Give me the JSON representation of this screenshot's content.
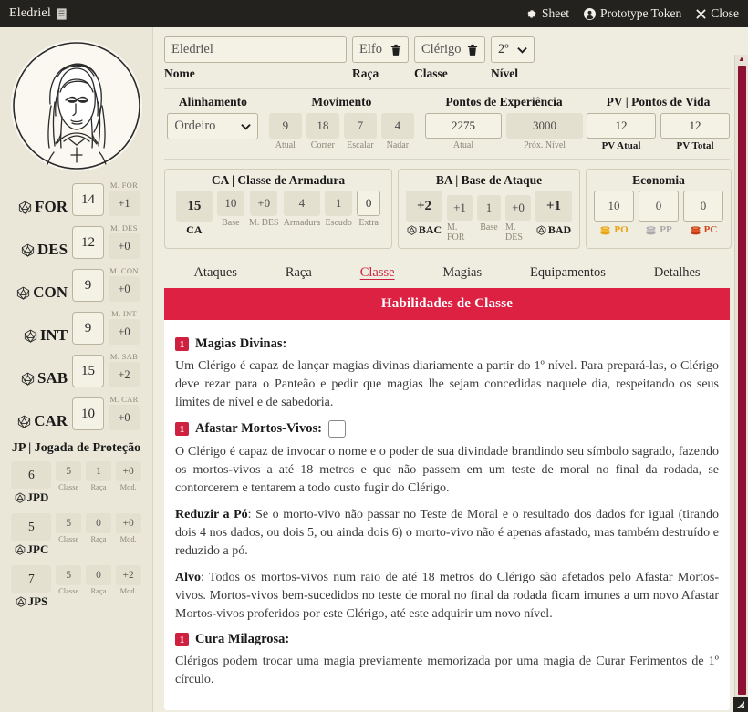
{
  "titlebar": {
    "character_name": "Eledriel",
    "doc_icon": "document-icon",
    "buttons": [
      {
        "label": "Sheet",
        "icon": "gear-icon"
      },
      {
        "label": "Prototype Token",
        "icon": "user-circle-icon"
      },
      {
        "label": "Close",
        "icon": "close-icon"
      }
    ]
  },
  "sidebar": {
    "portrait_alt": "character-portrait",
    "abilities": [
      {
        "key": "FOR",
        "score": "14",
        "mod_caption": "M. FOR",
        "mod": "+1"
      },
      {
        "key": "DES",
        "score": "12",
        "mod_caption": "M. DES",
        "mod": "+0"
      },
      {
        "key": "CON",
        "score": "9",
        "mod_caption": "M. CON",
        "mod": "+0"
      },
      {
        "key": "INT",
        "score": "9",
        "mod_caption": "M. INT",
        "mod": "+0"
      },
      {
        "key": "SAB",
        "score": "15",
        "mod_caption": "M. SAB",
        "mod": "+2"
      },
      {
        "key": "CAR",
        "score": "10",
        "mod_caption": "M. CAR",
        "mod": "+0"
      }
    ],
    "saves_title": "JP | Jogada de Proteção",
    "saves": [
      {
        "total": "6",
        "name": "JPD",
        "classe": "5",
        "raca": "1",
        "mod": "+0"
      },
      {
        "total": "5",
        "name": "JPC",
        "classe": "5",
        "raca": "0",
        "mod": "+0"
      },
      {
        "total": "7",
        "name": "JPS",
        "classe": "5",
        "raca": "0",
        "mod": "+2"
      }
    ],
    "save_captions": {
      "classe": "Classe",
      "raca": "Raça",
      "mod": "Mod."
    }
  },
  "identity": {
    "name_value": "Eledriel",
    "name_caption": "Nome",
    "race_value": "Elfo",
    "race_caption": "Raça",
    "class_value": "Clérigo",
    "class_caption": "Classe",
    "level_value": "2º",
    "level_caption": "Nível",
    "delete_icon": "trash-icon",
    "chevron_icon": "chevron-down-icon"
  },
  "stats_row": {
    "alignment": {
      "title": "Alinhamento",
      "value": "Ordeiro"
    },
    "movement": {
      "title": "Movimento",
      "cells": [
        {
          "value": "9",
          "caption": "Atual"
        },
        {
          "value": "18",
          "caption": "Correr"
        },
        {
          "value": "7",
          "caption": "Escalar"
        },
        {
          "value": "4",
          "caption": "Nadar"
        }
      ]
    },
    "experience": {
      "title": "Pontos de Experiência",
      "cells": [
        {
          "value": "2275",
          "caption": "Atual"
        },
        {
          "value": "3000",
          "caption": "Próx. Nível"
        }
      ]
    },
    "hitpoints": {
      "title": "PV | Pontos de Vida",
      "cells": [
        {
          "value": "12",
          "caption": "PV Atual"
        },
        {
          "value": "12",
          "caption": "PV Total"
        }
      ]
    }
  },
  "panels": {
    "armor": {
      "title": "CA | Classe de Armadura",
      "total": {
        "value": "15",
        "caption": "CA"
      },
      "cells": [
        {
          "value": "10",
          "caption": "Base"
        },
        {
          "value": "+0",
          "caption": "M. DES"
        },
        {
          "value": "4",
          "caption": "Armadura"
        },
        {
          "value": "1",
          "caption": "Escudo"
        },
        {
          "value": "0",
          "caption": "Extra",
          "editable": true
        }
      ]
    },
    "attack": {
      "title": "BA | Base de Ataque",
      "melee": {
        "value": "+2",
        "caption": "BAC",
        "icon": "d20-icon"
      },
      "cells": [
        {
          "value": "+1",
          "caption": "M. FOR"
        },
        {
          "value": "1",
          "caption": "Base"
        },
        {
          "value": "+0",
          "caption": "M. DES"
        }
      ],
      "ranged": {
        "value": "+1",
        "caption": "BAD",
        "icon": "d20-icon"
      }
    },
    "economy": {
      "title": "Economia",
      "coins": [
        {
          "value": "10",
          "caption": "PO",
          "color": "#e8a317",
          "icon": "coins-icon"
        },
        {
          "value": "0",
          "caption": "PP",
          "color": "#a9a9a9",
          "icon": "coins-icon"
        },
        {
          "value": "0",
          "caption": "PC",
          "color": "#d4431a",
          "icon": "coins-icon"
        }
      ]
    }
  },
  "tabs": [
    {
      "label": "Ataques",
      "active": false
    },
    {
      "label": "Raça",
      "active": false
    },
    {
      "label": "Classe",
      "active": true
    },
    {
      "label": "Magias",
      "active": false
    },
    {
      "label": "Equipamentos",
      "active": false
    },
    {
      "label": "Detalhes",
      "active": false
    }
  ],
  "content": {
    "banner": "Habilidades de Classe",
    "features": [
      {
        "badge": "1",
        "name": "Magias Divinas:",
        "has_checkbox": false,
        "paragraphs": [
          {
            "text": "Um Clérigo é capaz de lançar magias divinas diariamente a partir do 1º nível. Para prepará-las, o Clérigo deve rezar para o Panteão e pedir que magias lhe sejam concedidas naquele dia, respeitando os seus limites de nível e de sabedoria."
          }
        ]
      },
      {
        "badge": "1",
        "name": "Afastar Mortos-Vivos:",
        "has_checkbox": true,
        "paragraphs": [
          {
            "text": "O Clérigo é capaz de invocar o nome e o poder de sua divindade brandindo seu símbolo sagrado, fazendo os mortos-vivos a até 18 metros e que não passem em um teste de moral no final da rodada, se contorcerem e tentarem a todo custo fugir do Clérigo."
          },
          {
            "lead": "Reduzir a Pó",
            "text": ": Se o morto-vivo não passar no Teste de Moral e o resultado dos dados for igual (tirando dois 4 nos dados, ou dois 5, ou ainda dois 6) o morto-vivo não é apenas afastado, mas também destruído e reduzido a pó."
          },
          {
            "lead": "Alvo",
            "text": ": Todos os mortos-vivos num raio de até 18 metros do Clérigo são afetados pelo Afastar Mortos-vivos. Mortos-vivos bem-sucedidos no teste de moral no final da rodada ficam imunes a um novo Afastar Mortos-vivos proferidos por este Clérigo, até este adquirir um novo nível."
          }
        ]
      },
      {
        "badge": "1",
        "name": "Cura Milagrosa:",
        "has_checkbox": false,
        "paragraphs": [
          {
            "text": "Clérigos podem trocar uma magia previamente memorizada por uma magia de Curar Ferimentos de 1º círculo."
          }
        ]
      }
    ]
  },
  "scrollbar": {
    "arrow": "▲"
  },
  "colors": {
    "accent": "#dc2143",
    "badge": "#d0203f",
    "page_bg": "#efece0",
    "sidebar_bg": "#eae7d9",
    "titlebar_bg": "#23221f"
  }
}
